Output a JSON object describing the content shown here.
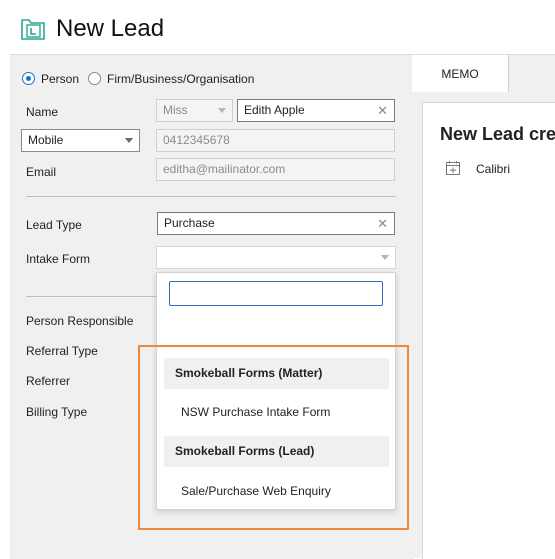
{
  "header": {
    "title": "New Lead"
  },
  "form": {
    "contact_type": {
      "option_person": "Person",
      "option_firm": "Firm/Business/Organisation"
    },
    "name_label": "Name",
    "title_value": "Miss",
    "name_value": "Edith Apple",
    "phone_type": "Mobile",
    "phone_value": "0412345678",
    "email_label": "Email",
    "email_value": "editha@mailinator.com",
    "lead_type_label": "Lead Type",
    "lead_type_value": "Purchase",
    "intake_form_label": "Intake Form",
    "person_responsible_label": "Person Responsible",
    "referral_type_label": "Referral Type",
    "referrer_label": "Referrer",
    "billing_type_label": "Billing Type"
  },
  "dropdown": {
    "search_value": "",
    "groups": [
      {
        "label": "Smokeball Forms (Matter)",
        "items": [
          "NSW Purchase Intake Form"
        ]
      },
      {
        "label": "Smokeball Forms (Lead)",
        "items": [
          "Sale/Purchase Web Enquiry"
        ]
      }
    ]
  },
  "memo": {
    "tab_label": "MEMO",
    "title": "New Lead cre",
    "font_name": "Calibri"
  },
  "colors": {
    "accent": "#1a73c9",
    "highlight": "#f0883a",
    "title_icon": "#2aa68e"
  },
  "icons": {
    "title": "lead-folder-icon",
    "clear": "close-icon",
    "dropdown": "chevron-down-icon",
    "memo_table": "table-insert-icon"
  }
}
